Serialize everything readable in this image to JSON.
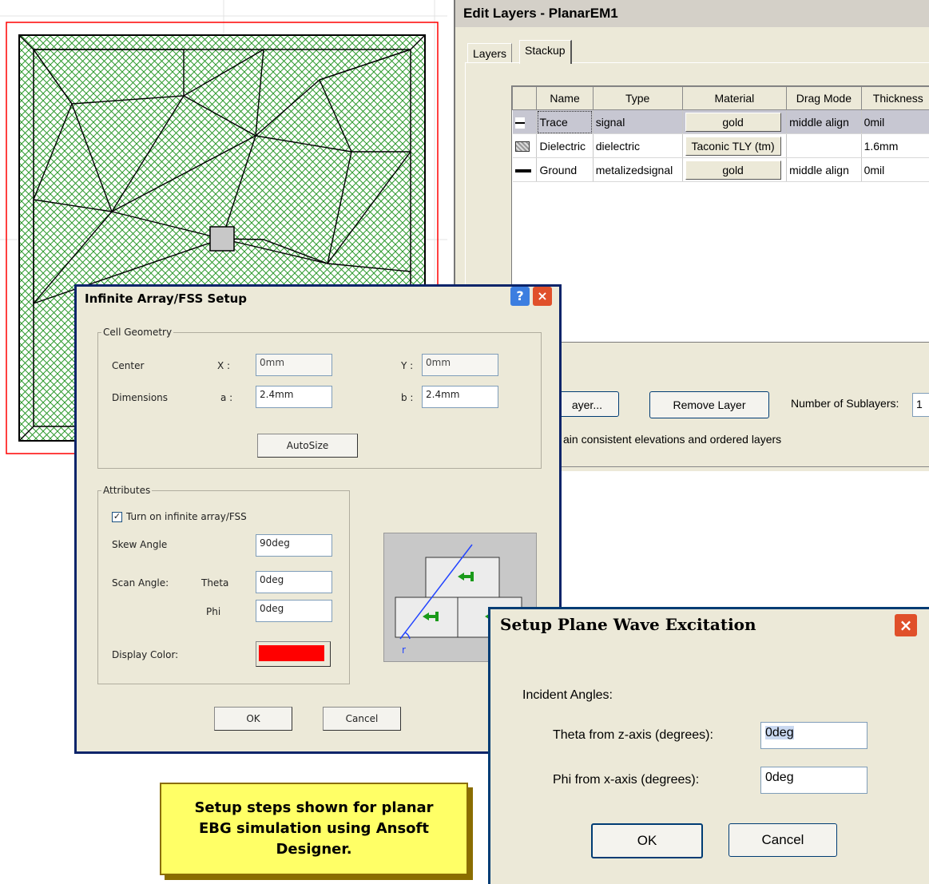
{
  "edit_layers": {
    "title": "Edit Layers - PlanarEM1",
    "tabs": [
      "Layers",
      "Stackup"
    ],
    "columns": [
      "Name",
      "Type",
      "Material",
      "Drag Mode",
      "Thickness"
    ],
    "rows": [
      {
        "swatch": "thin-line",
        "name": "Trace",
        "type": "signal",
        "material": "gold",
        "drag_mode": "middle align",
        "thickness": "0mil"
      },
      {
        "swatch": "hatched",
        "name": "Dielectric",
        "type": "dielectric",
        "material": "Taconic TLY (tm)",
        "drag_mode": "",
        "thickness": "1.6mm"
      },
      {
        "swatch": "thick-line",
        "name": "Ground",
        "type": "metalizedsignal",
        "material": "gold",
        "drag_mode": "middle align",
        "thickness": "0mil"
      }
    ],
    "add_layer_label": "ayer...",
    "remove_layer_label": "Remove Layer",
    "sublayers_label": "Number of Sublayers:",
    "sublayers_value": "1",
    "consistent_text": "ain consistent elevations and ordered layers"
  },
  "fss_dialog": {
    "title": "Infinite Array/FSS Setup",
    "help_icon": "?",
    "close_icon": "×",
    "cell_geometry_label": "Cell Geometry",
    "center_label": "Center",
    "x_label": "X :",
    "x_value": "0mm",
    "y_label": "Y :",
    "y_value": "0mm",
    "dimensions_label": "Dimensions",
    "a_label": "a :",
    "a_value": "2.4mm",
    "b_label": "b :",
    "b_value": "2.4mm",
    "autosize_label": "AutoSize",
    "attributes_label": "Attributes",
    "turn_on_label": "Turn on infinite array/FSS",
    "turn_on_checked": true,
    "skew_label": "Skew Angle",
    "skew_value": "90deg",
    "scan_label": "Scan Angle:",
    "theta_label": "Theta",
    "theta_value": "0deg",
    "phi_label": "Phi",
    "phi_value": "0deg",
    "display_color_label": "Display Color:",
    "display_color": "#ff0000",
    "ok_label": "OK",
    "cancel_label": "Cancel"
  },
  "plane_wave": {
    "title": "Setup Plane Wave Excitation",
    "close_icon": "×",
    "incident_label": "Incident Angles:",
    "theta_label": "Theta from z-axis (degrees):",
    "theta_value": "0deg",
    "phi_label": "Phi from x-axis (degrees):",
    "phi_value": "0deg",
    "ok_label": "OK",
    "cancel_label": "Cancel"
  },
  "note": {
    "text": "Setup steps shown for planar EBG simulation using Ansoft Designer."
  },
  "colors": {
    "mesh_fill": "#2e9a2e",
    "boundary": "#ff0000",
    "dialog_frame": "#0a246a",
    "note_bg": "#ffff66"
  }
}
